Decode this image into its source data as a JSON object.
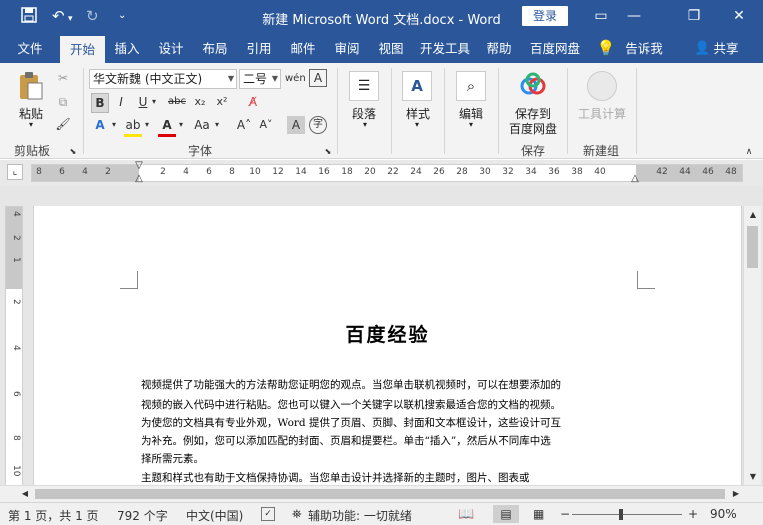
{
  "window": {
    "title": "新建 Microsoft Word 文档.docx  -  Word",
    "login_label": "登录",
    "quick_access": [
      "save-icon",
      "undo-icon",
      "redo-icon",
      "customize-icon"
    ],
    "controls": [
      "ribbon-display-icon",
      "minimize-icon",
      "restore-icon",
      "close-icon"
    ]
  },
  "tabs": [
    {
      "label": "文件",
      "active": false
    },
    {
      "label": "开始",
      "active": true
    },
    {
      "label": "插入",
      "active": false
    },
    {
      "label": "设计",
      "active": false
    },
    {
      "label": "布局",
      "active": false
    },
    {
      "label": "引用",
      "active": false
    },
    {
      "label": "邮件",
      "active": false
    },
    {
      "label": "审阅",
      "active": false
    },
    {
      "label": "视图",
      "active": false
    },
    {
      "label": "开发工具",
      "active": false
    },
    {
      "label": "帮助",
      "active": false
    },
    {
      "label": "百度网盘",
      "active": false
    }
  ],
  "tell_me": "告诉我",
  "share": "共享",
  "ribbon": {
    "clipboard": {
      "paste": "粘贴",
      "group_label": "剪贴板"
    },
    "font": {
      "font_name": "华文新魏 (中文正文)",
      "font_size": "二号",
      "group_label": "字体"
    },
    "paragraph": {
      "label": "段落"
    },
    "styles": {
      "label": "样式"
    },
    "editing": {
      "label": "编辑"
    },
    "save_baidu": {
      "line1": "保存到",
      "line2": "百度网盘",
      "group_label": "保存"
    },
    "tools": {
      "label": "工具计算",
      "group_label": "新建组"
    }
  },
  "ruler": {
    "h_numbers": [
      "8",
      "6",
      "4",
      "2",
      "2",
      "4",
      "6",
      "8",
      "10",
      "12",
      "14",
      "16",
      "18",
      "20",
      "22",
      "24",
      "26",
      "28",
      "30",
      "32",
      "34",
      "36",
      "38",
      "40",
      "42",
      "44",
      "46",
      "48"
    ],
    "v_numbers": [
      "4",
      "2",
      "1",
      "2",
      "4",
      "6",
      "8",
      "10"
    ]
  },
  "document": {
    "title": "百度经验",
    "lines": [
      "视频提供了功能强大的方法帮助您证明您的观点。当您单击联机视频时，可以在想要添加的",
      "视频的嵌入代码中进行粘贴。您也可以键入一个关键字以联机搜索最适合您的文档的视频。",
      "为使您的文档具有专业外观，Word 提供了页眉、页脚、封面和文本框设计，这些设计可互",
      "为补充。例如，您可以添加匹配的封面、页眉和提要栏。单击“插入”，然后从不同库中选",
      "择所需元素。",
      "主题和样式也有助于文档保持协调。当您单击设计并选择新的主题时，图片、图表或"
    ]
  },
  "status": {
    "page": "第 1 页，共 1 页",
    "words": "792 个字",
    "language": "中文(中国)",
    "accessibility": "辅助功能: 一切就绪",
    "zoom": "90%",
    "zoom_value": 90
  }
}
